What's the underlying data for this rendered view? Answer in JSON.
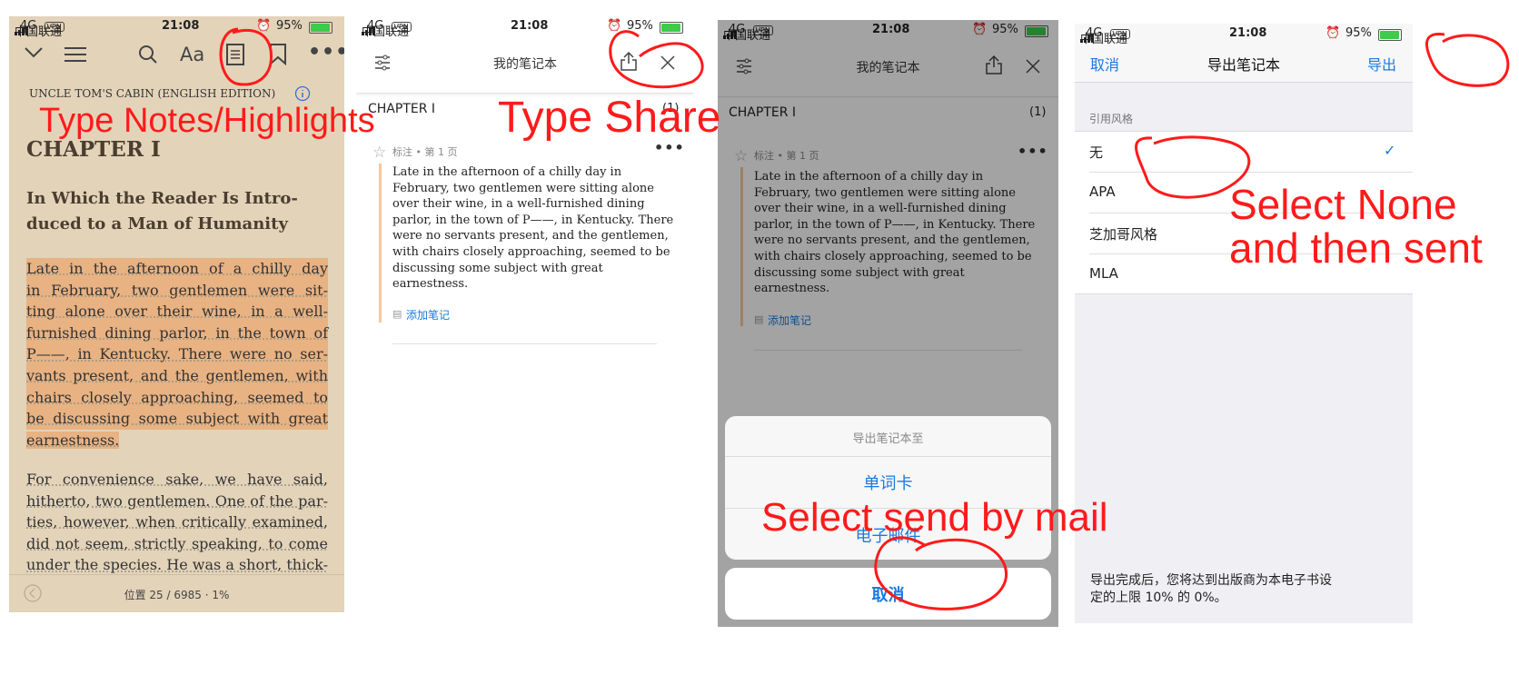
{
  "status": {
    "carrier": "中国联通",
    "network": "4G",
    "vpn": "VPN",
    "time": "21:08",
    "battery": "95%"
  },
  "panel1": {
    "book_title": "UNCLE TOM'S CABIN (ENGLISH EDITION)",
    "font_button": "Aa",
    "chapter": "CHAPTER I",
    "subtitle_line1": "In Which the Reader Is Intro-",
    "subtitle_line2": "duced to a Man of Humanity",
    "highlight_lines": [
      "Late in the afternoon of a chilly day",
      "in February, two gentlemen were sit-",
      "ting alone over their wine, in a well-",
      "furnished dining parlor, in the town of",
      "P——, in Kentucky. There were no ser-",
      "vants present, and the gentlemen, with",
      "chairs closely approaching, seemed to",
      "be discussing some subject with great",
      "earnestness."
    ],
    "body_lines": [
      "For convenience sake, we have said,",
      "hitherto, two gentlemen. One of the par-",
      "ties, however, when critically examined,",
      "did not seem, strictly speaking, to come",
      "under the species. He was a short, thick-"
    ],
    "location": "位置 25 / 6985 · 1%",
    "annotation": "Type Notes/Highlights"
  },
  "panel2": {
    "title": "我的笔记本",
    "chapter": "CHAPTER I",
    "count": "(1)",
    "note_meta": "标注 • 第 1 页",
    "note_lines": [
      "Late in the afternoon of a chilly day in",
      "February, two gentlemen were sitting alone",
      "over their wine, in a well-furnished dining",
      "parlor, in the town of P——, in Kentucky. There",
      "were no servants present, and the gentlemen,",
      "with chairs closely approaching, seemed to be",
      "discussing some subject with great",
      "earnestness."
    ],
    "add_note": "添加笔记",
    "annotation": "Type Share"
  },
  "panel3": {
    "title": "我的笔记本",
    "chapter": "CHAPTER I",
    "count": "(1)",
    "note_meta": "标注 • 第 1 页",
    "add_note": "添加笔记",
    "sheet_title": "导出笔记本至",
    "option_flashcards": "单词卡",
    "option_email": "电子邮件",
    "cancel": "取消",
    "annotation": "Select send by mail"
  },
  "panel4": {
    "cancel": "取消",
    "title": "导出笔记本",
    "export": "导出",
    "section_label": "引用风格",
    "options": [
      "无",
      "APA",
      "芝加哥风格",
      "MLA"
    ],
    "selected_mark": "✓",
    "footer_line1": "导出完成后，您将达到出版商为本电子书设",
    "footer_line2": "定的上限 10% 的 0%。",
    "annotation_line1": "Select None",
    "annotation_line2": "and then sent"
  },
  "colors": {
    "reader_bg": "#e3d3b9",
    "highlight": "#e8b282",
    "annotation_red": "#ff1a1a",
    "ios_blue": "#1a7ae0"
  }
}
